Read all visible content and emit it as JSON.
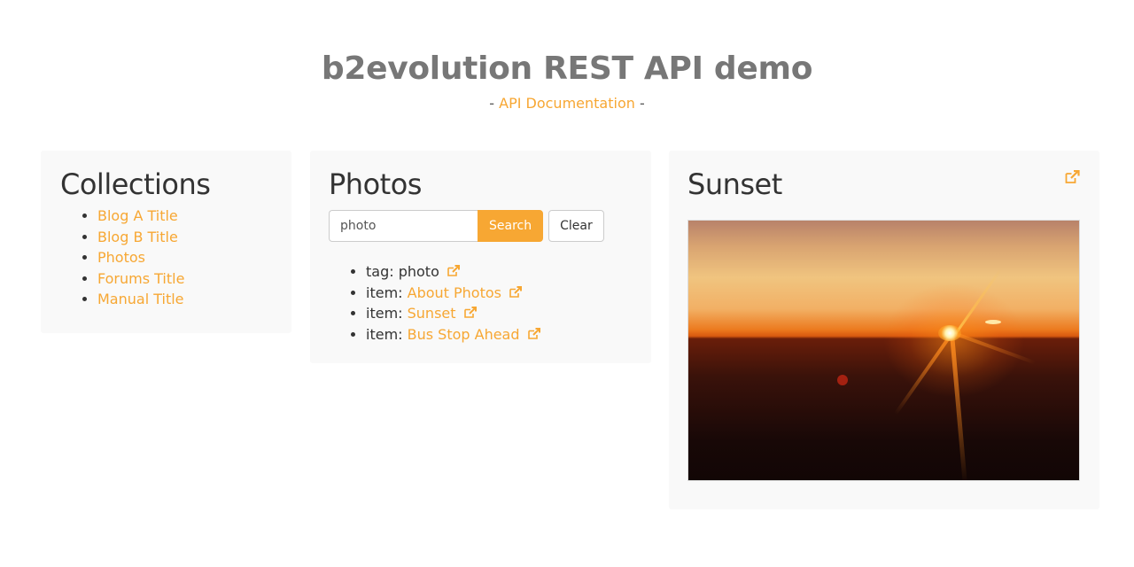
{
  "header": {
    "title": "b2evolution REST API demo",
    "subtitle_prefix": "- ",
    "subtitle_link": "API Documentation",
    "subtitle_suffix": " -"
  },
  "colors": {
    "accent": "#f7a733",
    "title": "#777777",
    "panel_bg": "#f9f9f9"
  },
  "collections": {
    "heading": "Collections",
    "items": [
      {
        "label": "Blog A Title"
      },
      {
        "label": "Blog B Title"
      },
      {
        "label": "Photos"
      },
      {
        "label": "Forums Title"
      },
      {
        "label": "Manual Title"
      }
    ]
  },
  "photos": {
    "heading": "Photos",
    "search": {
      "value": "photo",
      "search_label": "Search",
      "clear_label": "Clear"
    },
    "results": [
      {
        "prefix": "tag: ",
        "text": "photo",
        "linked": false,
        "icon": "external-link-icon"
      },
      {
        "prefix": "item: ",
        "text": "About Photos",
        "linked": true,
        "icon": "external-link-icon"
      },
      {
        "prefix": "item: ",
        "text": "Sunset",
        "linked": true,
        "icon": "external-link-icon"
      },
      {
        "prefix": "item: ",
        "text": "Bus Stop Ahead",
        "linked": true,
        "icon": "external-link-icon"
      }
    ]
  },
  "sunset": {
    "heading": "Sunset",
    "icon": "external-link-icon",
    "image_alt": "Sunset photo"
  }
}
